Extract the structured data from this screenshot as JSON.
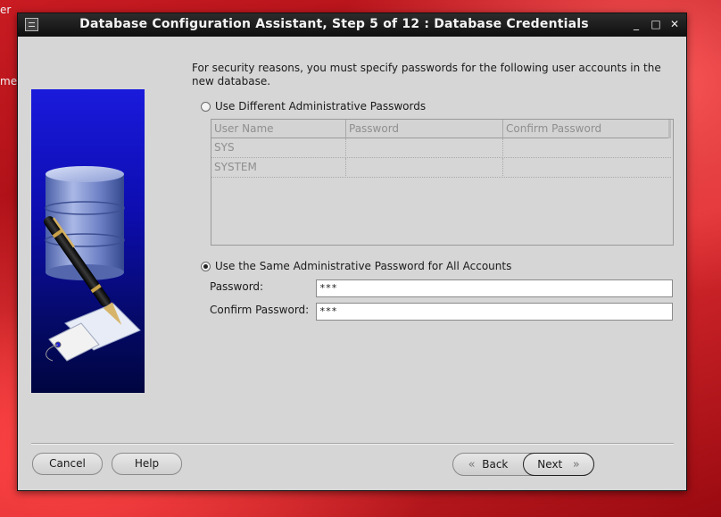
{
  "desktop": {
    "edge_text_1": "er",
    "edge_text_2": "me"
  },
  "window": {
    "title": "Database Configuration Assistant, Step 5 of 12 : Database Credentials",
    "minimize": "_",
    "maximize": "□",
    "close": "✕"
  },
  "intro_text": "For security reasons, you must specify passwords for the following user accounts in the new database.",
  "option_different": {
    "label": "Use Different Administrative Passwords",
    "selected": false
  },
  "table": {
    "columns": [
      "User Name",
      "Password",
      "Confirm Password"
    ],
    "rows": [
      {
        "user": "SYS",
        "password": "",
        "confirm": ""
      },
      {
        "user": "SYSTEM",
        "password": "",
        "confirm": ""
      }
    ]
  },
  "option_same": {
    "label": "Use the Same Administrative Password for All Accounts",
    "selected": true
  },
  "password_field": {
    "label": "Password:",
    "value": "***"
  },
  "confirm_field": {
    "label": "Confirm Password:",
    "value": "***"
  },
  "buttons": {
    "cancel": "Cancel",
    "help": "Help",
    "back": "Back",
    "next": "Next"
  },
  "colors": {
    "desktop_red": "#c91b22",
    "titlebar": "#1a1a1a",
    "dialog_bg": "#d6d6d6",
    "side_image_blue": "#1a1adc"
  },
  "icons": [
    "app-icon",
    "minimize-icon",
    "maximize-icon",
    "close-icon",
    "back-chevron-icon",
    "next-chevron-icon",
    "database-pen-illustration"
  ]
}
